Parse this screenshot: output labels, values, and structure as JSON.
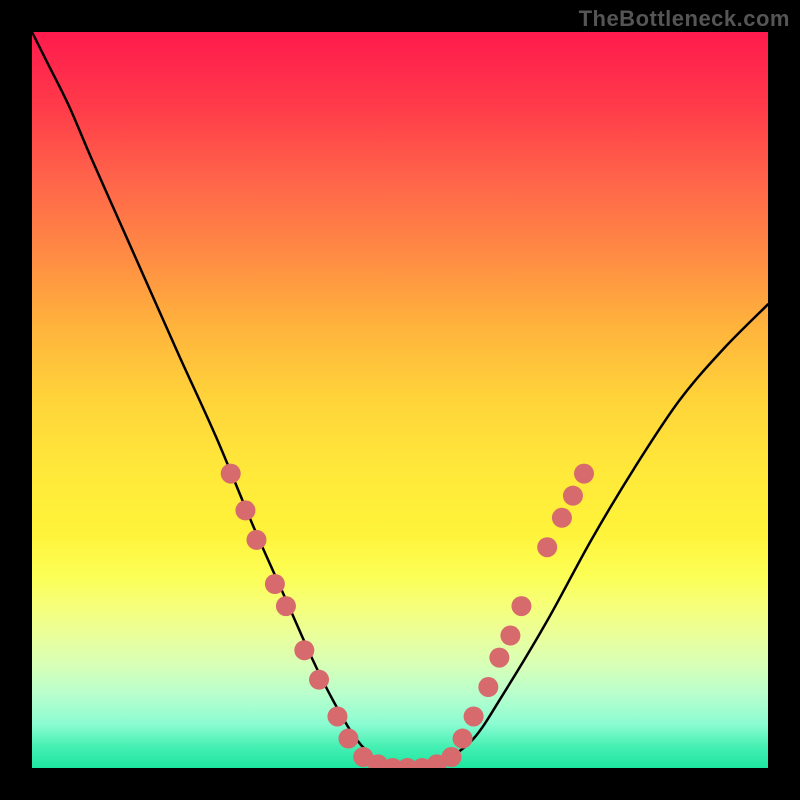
{
  "attribution": "TheBottleneck.com",
  "chart_data": {
    "type": "line",
    "title": "",
    "xlabel": "",
    "ylabel": "",
    "xlim": [
      0,
      100
    ],
    "ylim": [
      0,
      100
    ],
    "grid": false,
    "legend": false,
    "series": [
      {
        "name": "bottleneck-curve",
        "x": [
          0,
          2,
          5,
          8,
          12,
          16,
          20,
          25,
          30,
          34,
          38,
          41,
          44,
          47,
          50,
          53,
          56,
          60,
          64,
          70,
          76,
          82,
          88,
          94,
          100
        ],
        "y": [
          100,
          96,
          90,
          83,
          74,
          65,
          56,
          45,
          33,
          24,
          15,
          9,
          4,
          1,
          0,
          0,
          1,
          4,
          10,
          20,
          31,
          41,
          50,
          57,
          63
        ]
      }
    ],
    "markers": {
      "name": "highlighted-points",
      "color": "#d66a6d",
      "points": [
        {
          "x": 27,
          "y": 40
        },
        {
          "x": 29,
          "y": 35
        },
        {
          "x": 30.5,
          "y": 31
        },
        {
          "x": 33,
          "y": 25
        },
        {
          "x": 34.5,
          "y": 22
        },
        {
          "x": 37,
          "y": 16
        },
        {
          "x": 39,
          "y": 12
        },
        {
          "x": 41.5,
          "y": 7
        },
        {
          "x": 43,
          "y": 4
        },
        {
          "x": 45,
          "y": 1.5
        },
        {
          "x": 47,
          "y": 0.5
        },
        {
          "x": 49,
          "y": 0
        },
        {
          "x": 51,
          "y": 0
        },
        {
          "x": 53,
          "y": 0
        },
        {
          "x": 55,
          "y": 0.5
        },
        {
          "x": 57,
          "y": 1.5
        },
        {
          "x": 58.5,
          "y": 4
        },
        {
          "x": 60,
          "y": 7
        },
        {
          "x": 62,
          "y": 11
        },
        {
          "x": 63.5,
          "y": 15
        },
        {
          "x": 65,
          "y": 18
        },
        {
          "x": 66.5,
          "y": 22
        },
        {
          "x": 70,
          "y": 30
        },
        {
          "x": 72,
          "y": 34
        },
        {
          "x": 73.5,
          "y": 37
        },
        {
          "x": 75,
          "y": 40
        }
      ]
    }
  }
}
